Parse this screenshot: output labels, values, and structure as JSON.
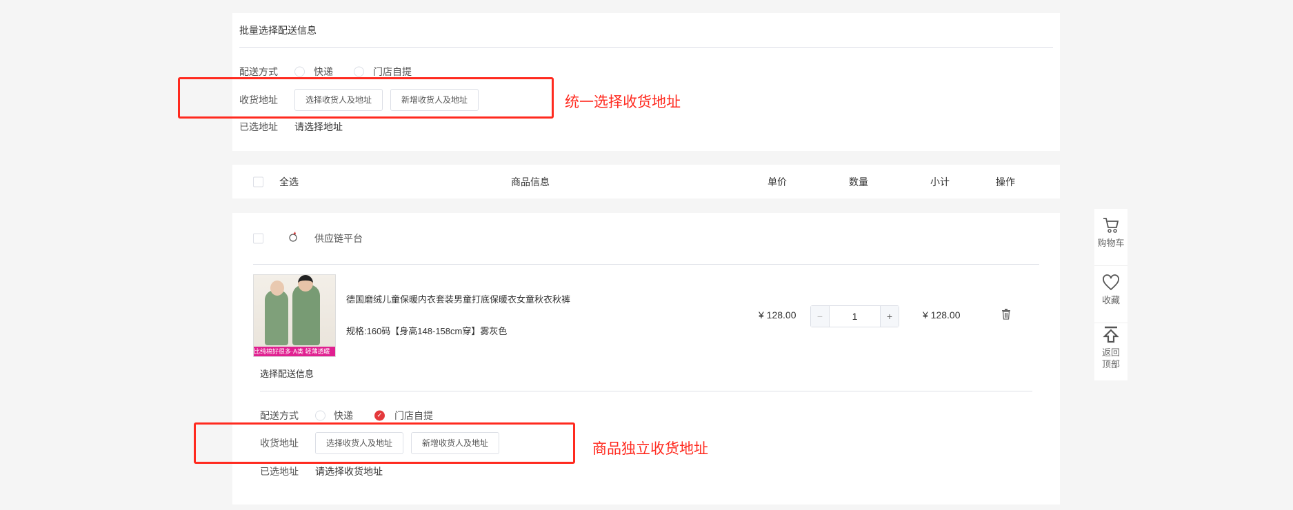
{
  "batch": {
    "title": "批量选择配送信息",
    "delivery_label": "配送方式",
    "opt_express": "快递",
    "opt_pickup": "门店自提",
    "address_label": "收货地址",
    "btn_select": "选择收货人及地址",
    "btn_new": "新增收货人及地址",
    "selected_label": "已选地址",
    "selected_value": "请选择地址",
    "annotation": "统一选择收货地址"
  },
  "header": {
    "select_all": "全选",
    "product_info": "商品信息",
    "unit_price": "单价",
    "quantity": "数量",
    "subtotal": "小计",
    "action": "操作"
  },
  "shop": {
    "name": "供应链平台"
  },
  "item": {
    "title": "德国磨绒儿童保暖内衣套装男童打底保暖衣女童秋衣秋裤",
    "spec": "规格:160码【身高148-158cm穿】雾灰色",
    "image_banner": "比纯棉好很多·A类 轻薄透暖",
    "price": "¥ 128.00",
    "qty": "1",
    "subtotal": "¥ 128.00",
    "delivery": {
      "title": "选择配送信息",
      "delivery_label": "配送方式",
      "opt_express": "快递",
      "opt_pickup": "门店自提",
      "selected_option": "门店自提",
      "address_label": "收货地址",
      "btn_select": "选择收货人及地址",
      "btn_new": "新增收货人及地址",
      "selected_label": "已选地址",
      "selected_value": "请选择收货地址",
      "annotation": "商品独立收货地址"
    }
  },
  "sidebar": {
    "cart": "购物车",
    "favorite": "收藏",
    "top1": "返回",
    "top2": "顶部"
  },
  "colors": {
    "accent": "#e4393c",
    "annotation": "#ff2a1f"
  }
}
